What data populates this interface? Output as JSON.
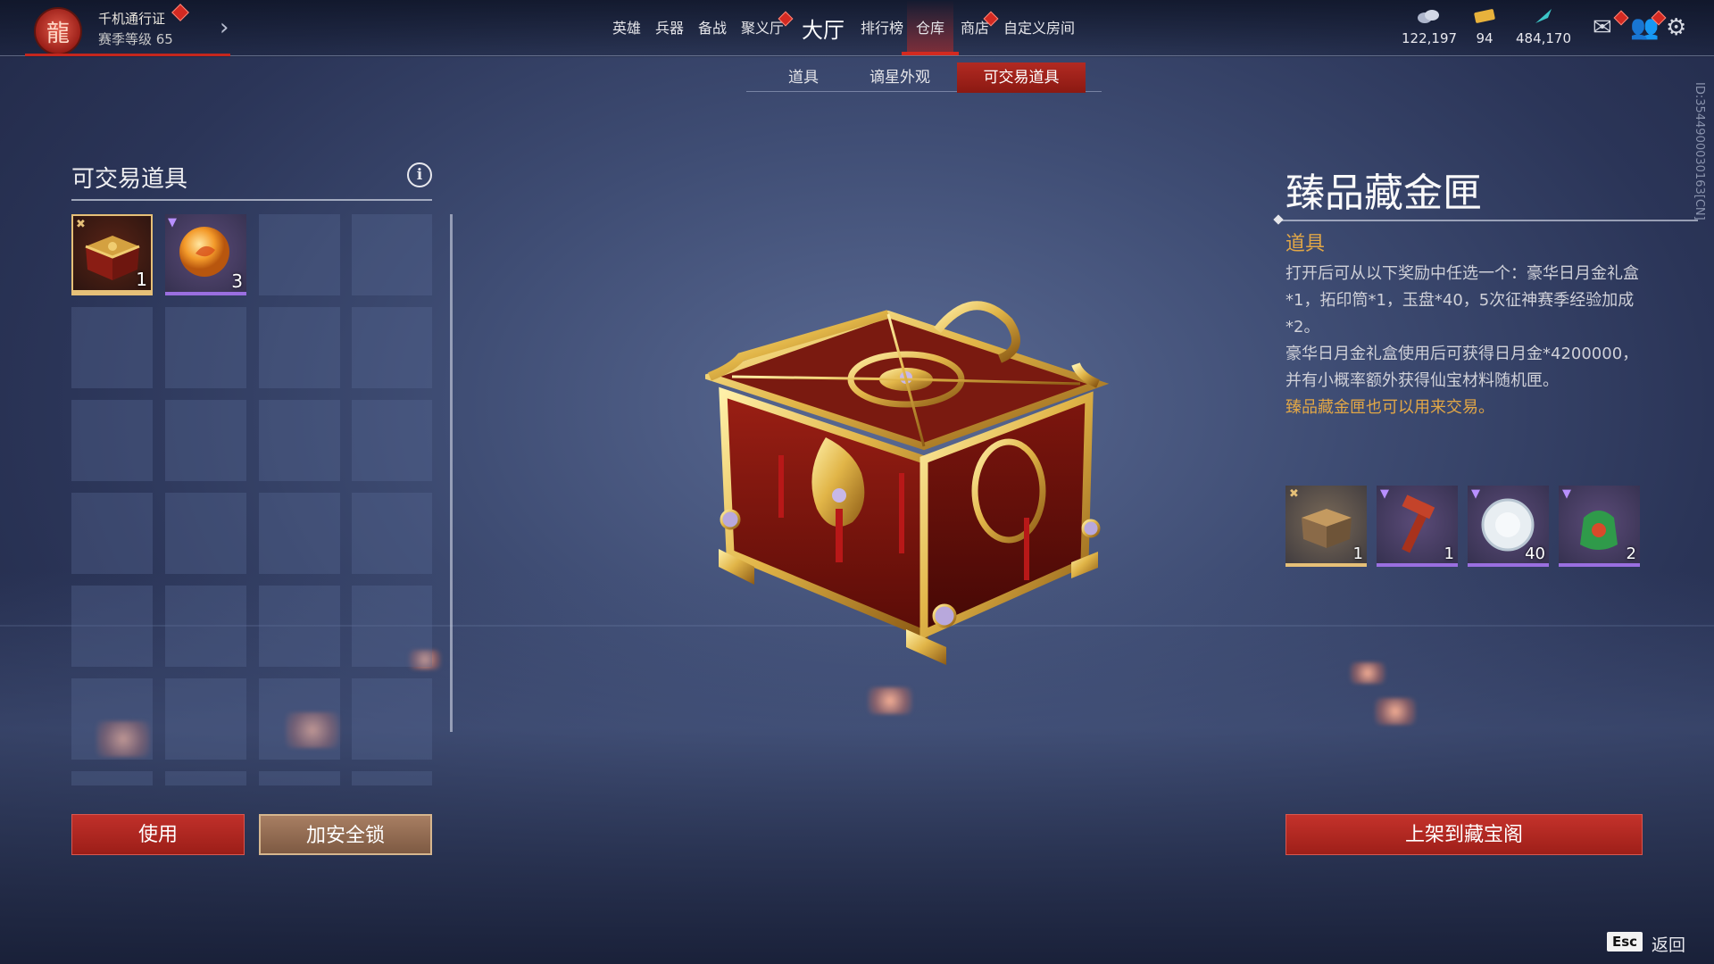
{
  "topbar": {
    "pass_title": "千机通行证",
    "pass_level": "赛季等级 65",
    "nav": [
      "英雄",
      "兵器",
      "备战",
      "聚义厅",
      "大厅",
      "排行榜",
      "仓库",
      "商店",
      "自定义房间"
    ],
    "active_nav": "仓库",
    "currencies": [
      {
        "icon": "coin-pile-icon",
        "value": "122,197",
        "color": "#b8c0d6"
      },
      {
        "icon": "ticket-icon",
        "value": "94",
        "color": "#e8b23c"
      },
      {
        "icon": "feather-icon",
        "value": "484,170",
        "color": "#3cc6c8"
      }
    ]
  },
  "subtabs": [
    "道具",
    "谪星外观",
    "可交易道具"
  ],
  "active_subtab": "可交易道具",
  "left_panel": {
    "title": "可交易道具",
    "items": [
      {
        "name": "treasure-chest-item",
        "qty": "1",
        "quality": "gold"
      },
      {
        "name": "orange-orb-item",
        "qty": "3",
        "quality": "purple"
      }
    ],
    "use_button": "使用",
    "lock_button": "加安全锁"
  },
  "detail": {
    "item_name": "臻品藏金匣",
    "item_type": "道具",
    "desc1": "打开后可从以下奖励中任选一个：豪华日月金礼盒*1，拓印筒*1，玉盘*40，5次征神赛季经验加成*2。",
    "desc2": "豪华日月金礼盒使用后可获得日月金*4200000，并有小概率额外获得仙宝材料随机匣。",
    "desc3": "臻品藏金匣也可以用来交易。",
    "rewards": [
      {
        "name": "gift-box-reward",
        "qty": "1",
        "quality": "gold"
      },
      {
        "name": "stamp-tube-reward",
        "qty": "1",
        "quality": "purple"
      },
      {
        "name": "jade-plate-reward",
        "qty": "40",
        "quality": "purple"
      },
      {
        "name": "exp-boost-reward",
        "qty": "2",
        "quality": "purple"
      }
    ],
    "list_button": "上架到藏宝阁"
  },
  "side_id": "ID:3544900030163[CN]",
  "footer": {
    "esc_key": "Esc",
    "back_label": "返回"
  },
  "colors": {
    "accent_red": "#c4261d",
    "gold": "#e2a746",
    "purple_quality": "#9a6fe0",
    "gold_quality": "#e6c078"
  }
}
